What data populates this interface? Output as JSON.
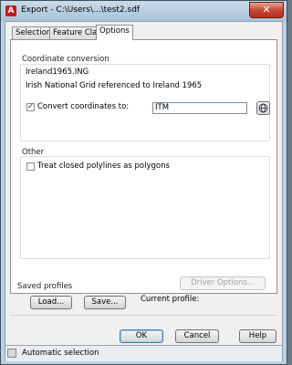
{
  "window": {
    "title": "Export - C:\\Users\\...\\test2.sdf",
    "close_glyph": "✕"
  },
  "tabs": [
    {
      "label": "Selection"
    },
    {
      "label": "Feature Class"
    },
    {
      "label": "Options",
      "active": true
    }
  ],
  "coordinate_conversion": {
    "section_title": "Coordinate conversion",
    "code": "Ireland1965.ING",
    "description": "Irish National Grid referenced to Ireland 1965",
    "convert_label": "Convert coordinates to:",
    "convert_checked": true,
    "target_value": "ITM",
    "globe_icon": "globe-icon"
  },
  "other": {
    "section_title": "Other",
    "treat_polylines_label": "Treat closed polylines as polygons",
    "treat_polylines_checked": false
  },
  "driver_options_label": "Driver Options...",
  "saved_profiles": {
    "section_title": "Saved profiles",
    "load_label": "Load...",
    "save_label": "Save...",
    "current_profile_label": "Current profile:"
  },
  "dialog_buttons": {
    "ok_label": "OK",
    "cancel_label": "Cancel",
    "help_label": "Help"
  },
  "status": {
    "text": "Automatic selection"
  }
}
